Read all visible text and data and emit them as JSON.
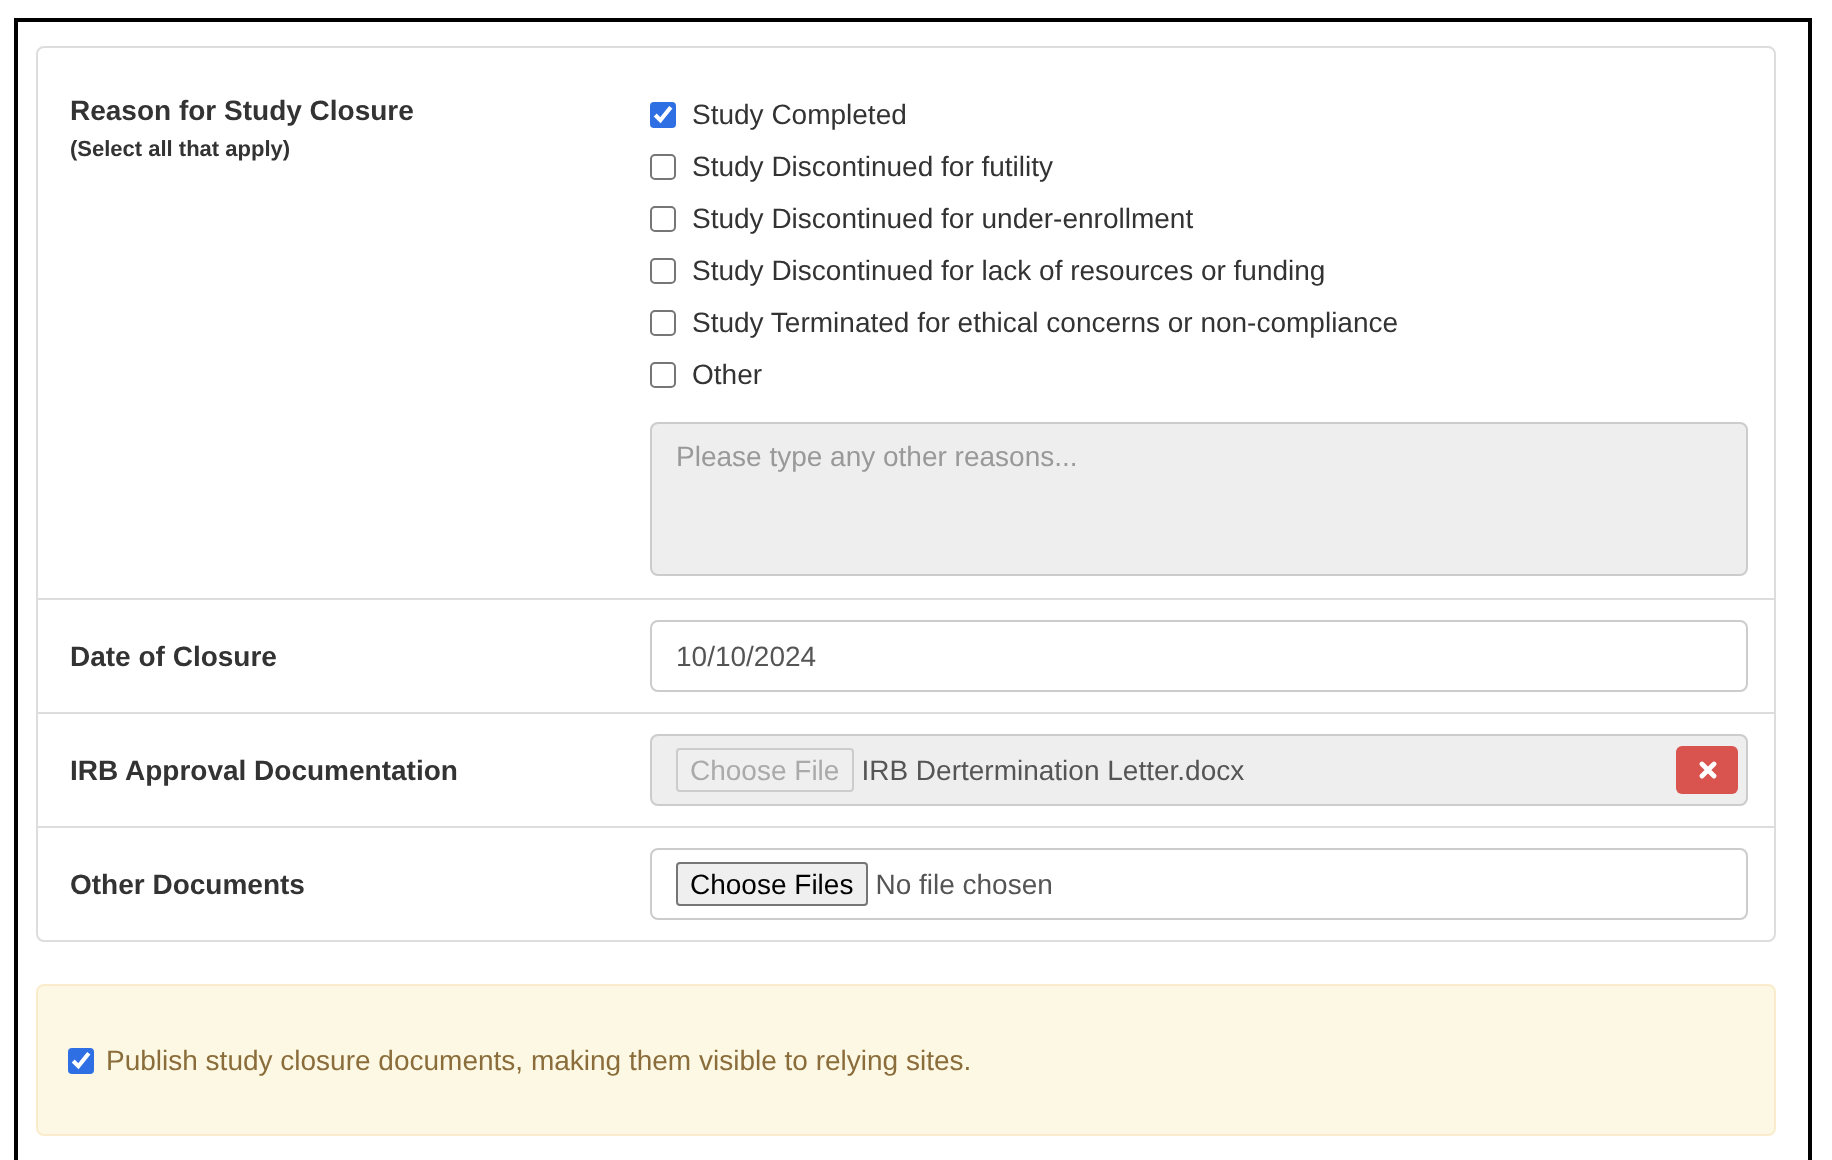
{
  "reason": {
    "label": "Reason for Study Closure",
    "hint": "(Select all that apply)",
    "options": [
      {
        "label": "Study Completed",
        "checked": true
      },
      {
        "label": "Study Discontinued for futility",
        "checked": false
      },
      {
        "label": "Study Discontinued for under-enrollment",
        "checked": false
      },
      {
        "label": "Study Discontinued for lack of resources or funding",
        "checked": false
      },
      {
        "label": "Study Terminated for ethical concerns or non-compliance",
        "checked": false
      },
      {
        "label": "Other",
        "checked": false
      }
    ],
    "other_field": {
      "placeholder": "Please type any other reasons...",
      "disabled": true
    }
  },
  "date": {
    "label": "Date of Closure",
    "value": "10/10/2024"
  },
  "files": [
    {
      "label": "IRB Approval Documentation",
      "button": "Choose File",
      "file_name": "IRB Dertermination Letter.docx",
      "disabled": true,
      "removable": true
    },
    {
      "label": "Other Documents",
      "button": "Choose Files",
      "file_name": "No file chosen",
      "disabled": false,
      "removable": false
    }
  ],
  "publish": {
    "label": "Publish study closure documents, making them visible to relying sites.",
    "checked": true
  }
}
